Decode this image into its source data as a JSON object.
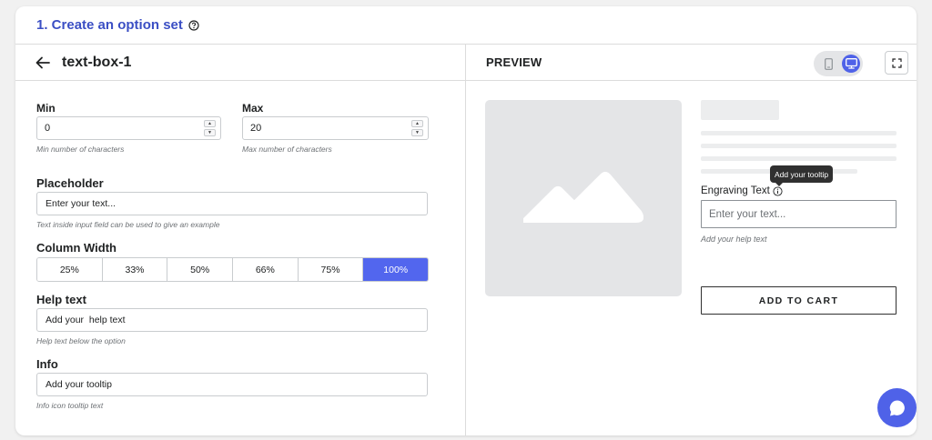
{
  "header": {
    "title": "1. Create an option set"
  },
  "editor": {
    "option_name": "text-box-1",
    "min": {
      "label": "Min",
      "value": "0",
      "hint": "Min number of characters"
    },
    "max": {
      "label": "Max",
      "value": "20",
      "hint": "Max number of characters"
    },
    "placeholder": {
      "label": "Placeholder",
      "value": "Enter your text...",
      "hint": "Text inside input field can be used to give an example"
    },
    "column_width": {
      "label": "Column Width",
      "options": [
        "25%",
        "33%",
        "50%",
        "66%",
        "75%",
        "100%"
      ],
      "selected": "100%"
    },
    "help_text": {
      "label": "Help text",
      "value": "Add your  help text",
      "hint": "Help text below the option"
    },
    "info": {
      "label": "Info",
      "value": "Add your tooltip",
      "hint": "Info icon tooltip text"
    }
  },
  "preview": {
    "title": "PREVIEW",
    "tooltip": "Add your tooltip",
    "field_label": "Engraving Text",
    "input_placeholder": "Enter your text...",
    "help_text": "Add your help text",
    "cart_button": "ADD TO CART"
  },
  "colors": {
    "accent": "#4f62e8",
    "title_blue": "#3b4fc4"
  },
  "icons": [
    "help-circle-icon",
    "arrow-left-icon",
    "mobile-icon",
    "desktop-icon",
    "fullscreen-icon",
    "image-placeholder-icon",
    "info-icon",
    "chat-icon"
  ]
}
